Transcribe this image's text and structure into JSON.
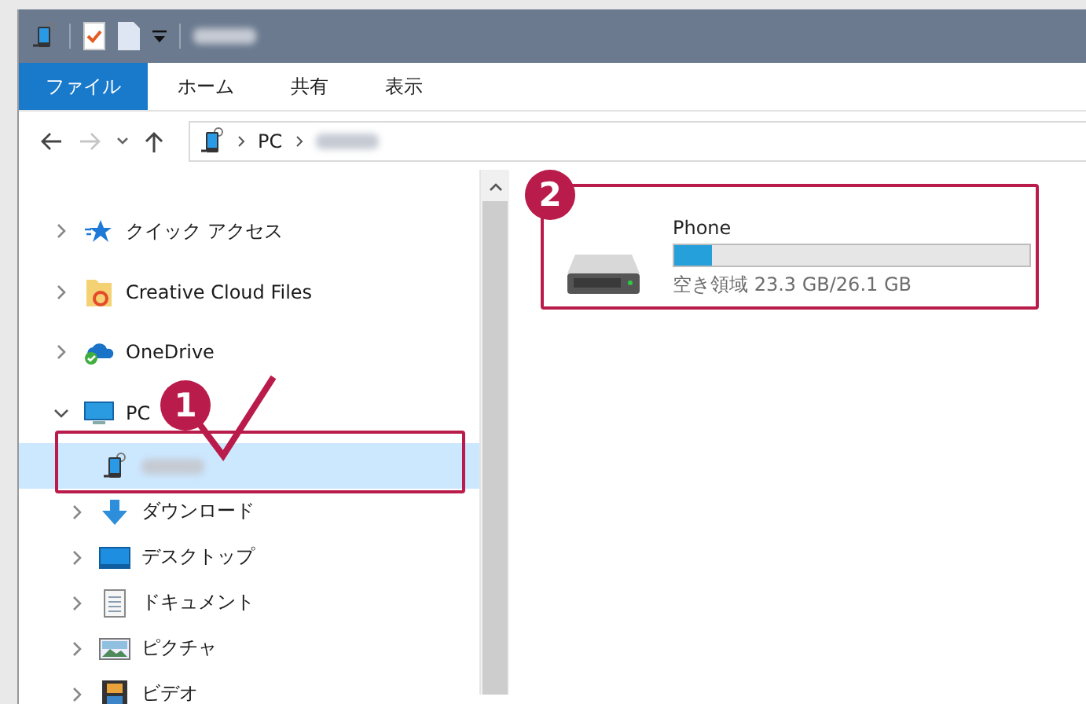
{
  "ribbon_tabs": [
    {
      "label": "ファイル",
      "selected": true
    },
    {
      "label": "ホーム",
      "selected": false
    },
    {
      "label": "共有",
      "selected": false
    },
    {
      "label": "表示",
      "selected": false
    }
  ],
  "address_bar": {
    "back_enabled": true,
    "forward_enabled": false,
    "path": [
      "PC"
    ]
  },
  "nav_tree": [
    {
      "label": "クイック アクセス",
      "kind": "star",
      "expanded": false,
      "selected": false
    },
    {
      "label": "Creative Cloud Files",
      "kind": "folder",
      "expanded": false,
      "selected": false
    },
    {
      "label": "OneDrive",
      "kind": "cloud",
      "expanded": false,
      "selected": false
    },
    {
      "label": "PC",
      "kind": "monitor",
      "expanded": true,
      "selected": false,
      "children": [
        {
          "kind": "phone",
          "selected": true,
          "blurred": true
        },
        {
          "label": "ダウンロード",
          "kind": "download",
          "expanded": false,
          "selected": false
        },
        {
          "label": "デスクトップ",
          "kind": "desktop",
          "expanded": false,
          "selected": false
        },
        {
          "label": "ドキュメント",
          "kind": "document",
          "expanded": false,
          "selected": false
        },
        {
          "label": "ピクチャ",
          "kind": "picture",
          "expanded": false,
          "selected": false
        },
        {
          "label": "ビデオ",
          "kind": "video",
          "expanded": false,
          "selected": false
        }
      ]
    }
  ],
  "drives": [
    {
      "name": "Phone",
      "level": 0.107,
      "free_space": "空き領域 23.3 GB/26.1 GB"
    }
  ],
  "annotations": [
    {
      "number": "1"
    },
    {
      "number": "2"
    }
  ]
}
